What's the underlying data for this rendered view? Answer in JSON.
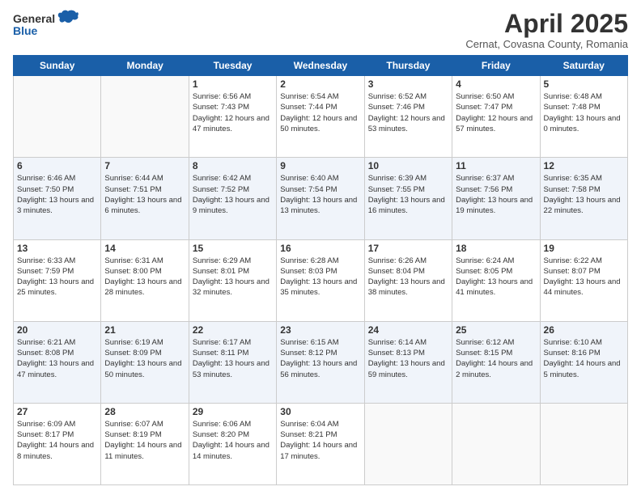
{
  "logo": {
    "general": "General",
    "blue": "Blue"
  },
  "title": "April 2025",
  "subtitle": "Cernat, Covasna County, Romania",
  "headers": [
    "Sunday",
    "Monday",
    "Tuesday",
    "Wednesday",
    "Thursday",
    "Friday",
    "Saturday"
  ],
  "weeks": [
    [
      {
        "day": "",
        "info": ""
      },
      {
        "day": "",
        "info": ""
      },
      {
        "day": "1",
        "info": "Sunrise: 6:56 AM\nSunset: 7:43 PM\nDaylight: 12 hours and 47 minutes."
      },
      {
        "day": "2",
        "info": "Sunrise: 6:54 AM\nSunset: 7:44 PM\nDaylight: 12 hours and 50 minutes."
      },
      {
        "day": "3",
        "info": "Sunrise: 6:52 AM\nSunset: 7:46 PM\nDaylight: 12 hours and 53 minutes."
      },
      {
        "day": "4",
        "info": "Sunrise: 6:50 AM\nSunset: 7:47 PM\nDaylight: 12 hours and 57 minutes."
      },
      {
        "day": "5",
        "info": "Sunrise: 6:48 AM\nSunset: 7:48 PM\nDaylight: 13 hours and 0 minutes."
      }
    ],
    [
      {
        "day": "6",
        "info": "Sunrise: 6:46 AM\nSunset: 7:50 PM\nDaylight: 13 hours and 3 minutes."
      },
      {
        "day": "7",
        "info": "Sunrise: 6:44 AM\nSunset: 7:51 PM\nDaylight: 13 hours and 6 minutes."
      },
      {
        "day": "8",
        "info": "Sunrise: 6:42 AM\nSunset: 7:52 PM\nDaylight: 13 hours and 9 minutes."
      },
      {
        "day": "9",
        "info": "Sunrise: 6:40 AM\nSunset: 7:54 PM\nDaylight: 13 hours and 13 minutes."
      },
      {
        "day": "10",
        "info": "Sunrise: 6:39 AM\nSunset: 7:55 PM\nDaylight: 13 hours and 16 minutes."
      },
      {
        "day": "11",
        "info": "Sunrise: 6:37 AM\nSunset: 7:56 PM\nDaylight: 13 hours and 19 minutes."
      },
      {
        "day": "12",
        "info": "Sunrise: 6:35 AM\nSunset: 7:58 PM\nDaylight: 13 hours and 22 minutes."
      }
    ],
    [
      {
        "day": "13",
        "info": "Sunrise: 6:33 AM\nSunset: 7:59 PM\nDaylight: 13 hours and 25 minutes."
      },
      {
        "day": "14",
        "info": "Sunrise: 6:31 AM\nSunset: 8:00 PM\nDaylight: 13 hours and 28 minutes."
      },
      {
        "day": "15",
        "info": "Sunrise: 6:29 AM\nSunset: 8:01 PM\nDaylight: 13 hours and 32 minutes."
      },
      {
        "day": "16",
        "info": "Sunrise: 6:28 AM\nSunset: 8:03 PM\nDaylight: 13 hours and 35 minutes."
      },
      {
        "day": "17",
        "info": "Sunrise: 6:26 AM\nSunset: 8:04 PM\nDaylight: 13 hours and 38 minutes."
      },
      {
        "day": "18",
        "info": "Sunrise: 6:24 AM\nSunset: 8:05 PM\nDaylight: 13 hours and 41 minutes."
      },
      {
        "day": "19",
        "info": "Sunrise: 6:22 AM\nSunset: 8:07 PM\nDaylight: 13 hours and 44 minutes."
      }
    ],
    [
      {
        "day": "20",
        "info": "Sunrise: 6:21 AM\nSunset: 8:08 PM\nDaylight: 13 hours and 47 minutes."
      },
      {
        "day": "21",
        "info": "Sunrise: 6:19 AM\nSunset: 8:09 PM\nDaylight: 13 hours and 50 minutes."
      },
      {
        "day": "22",
        "info": "Sunrise: 6:17 AM\nSunset: 8:11 PM\nDaylight: 13 hours and 53 minutes."
      },
      {
        "day": "23",
        "info": "Sunrise: 6:15 AM\nSunset: 8:12 PM\nDaylight: 13 hours and 56 minutes."
      },
      {
        "day": "24",
        "info": "Sunrise: 6:14 AM\nSunset: 8:13 PM\nDaylight: 13 hours and 59 minutes."
      },
      {
        "day": "25",
        "info": "Sunrise: 6:12 AM\nSunset: 8:15 PM\nDaylight: 14 hours and 2 minutes."
      },
      {
        "day": "26",
        "info": "Sunrise: 6:10 AM\nSunset: 8:16 PM\nDaylight: 14 hours and 5 minutes."
      }
    ],
    [
      {
        "day": "27",
        "info": "Sunrise: 6:09 AM\nSunset: 8:17 PM\nDaylight: 14 hours and 8 minutes."
      },
      {
        "day": "28",
        "info": "Sunrise: 6:07 AM\nSunset: 8:19 PM\nDaylight: 14 hours and 11 minutes."
      },
      {
        "day": "29",
        "info": "Sunrise: 6:06 AM\nSunset: 8:20 PM\nDaylight: 14 hours and 14 minutes."
      },
      {
        "day": "30",
        "info": "Sunrise: 6:04 AM\nSunset: 8:21 PM\nDaylight: 14 hours and 17 minutes."
      },
      {
        "day": "",
        "info": ""
      },
      {
        "day": "",
        "info": ""
      },
      {
        "day": "",
        "info": ""
      }
    ]
  ]
}
